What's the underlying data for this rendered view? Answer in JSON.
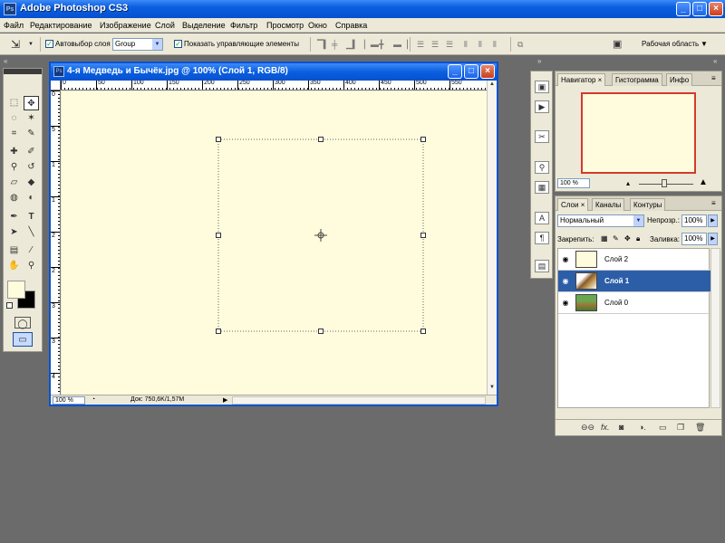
{
  "app": {
    "title": "Adobe Photoshop CS3",
    "icon_text": "Ps",
    "window_buttons": {
      "minimize": "_",
      "maximize": "□",
      "close": "×"
    }
  },
  "menu": [
    "Файл",
    "Редактирование",
    "Изображение",
    "Слой",
    "Выделение",
    "Фильтр",
    "Просмотр",
    "Окно",
    "Справка"
  ],
  "options": {
    "auto_select_label": "Автовыбор слоя",
    "auto_select_checked": true,
    "auto_select_value": "Group",
    "show_controls_label": "Показать управляющие элементы",
    "show_controls_checked": true,
    "workspace_label": "Рабочая область"
  },
  "document": {
    "title": "4-я Медведь и Бычёк.jpg @ 100% (Слой 1, RGB/8)",
    "zoom": "100 %",
    "doc_info": "Док: 750,6K/1,57M",
    "canvas_color": "#fefcdc",
    "ruler_h_labels": [
      "0",
      "50",
      "100",
      "150",
      "200",
      "250",
      "300",
      "350",
      "400",
      "450",
      "500",
      "550"
    ],
    "ruler_v_labels": [
      "0",
      "5",
      "1",
      "1",
      "2",
      "2",
      "3",
      "3",
      "4",
      "4"
    ]
  },
  "navigator": {
    "tabs": [
      "Навигатор",
      "Гистограмма",
      "Инфо"
    ],
    "zoom": "100 %",
    "frame_color": "#d33a2c"
  },
  "layers_panel": {
    "tabs": [
      "Слои",
      "Каналы",
      "Контуры"
    ],
    "blend_mode": "Нормальный",
    "opacity_label": "Непрозр.:",
    "opacity_value": "100%",
    "lock_label": "Закрепить:",
    "fill_label": "Заливка:",
    "fill_value": "100%",
    "layers": [
      {
        "name": "Слой 2",
        "selected": false
      },
      {
        "name": "Слой 1",
        "selected": true
      },
      {
        "name": "Слой 0",
        "selected": false
      }
    ]
  },
  "colors": {
    "xp_blue": "#0a5fe0",
    "selection": "#2c5ea8",
    "foreground": "#fefcdc",
    "background": "#000000"
  }
}
